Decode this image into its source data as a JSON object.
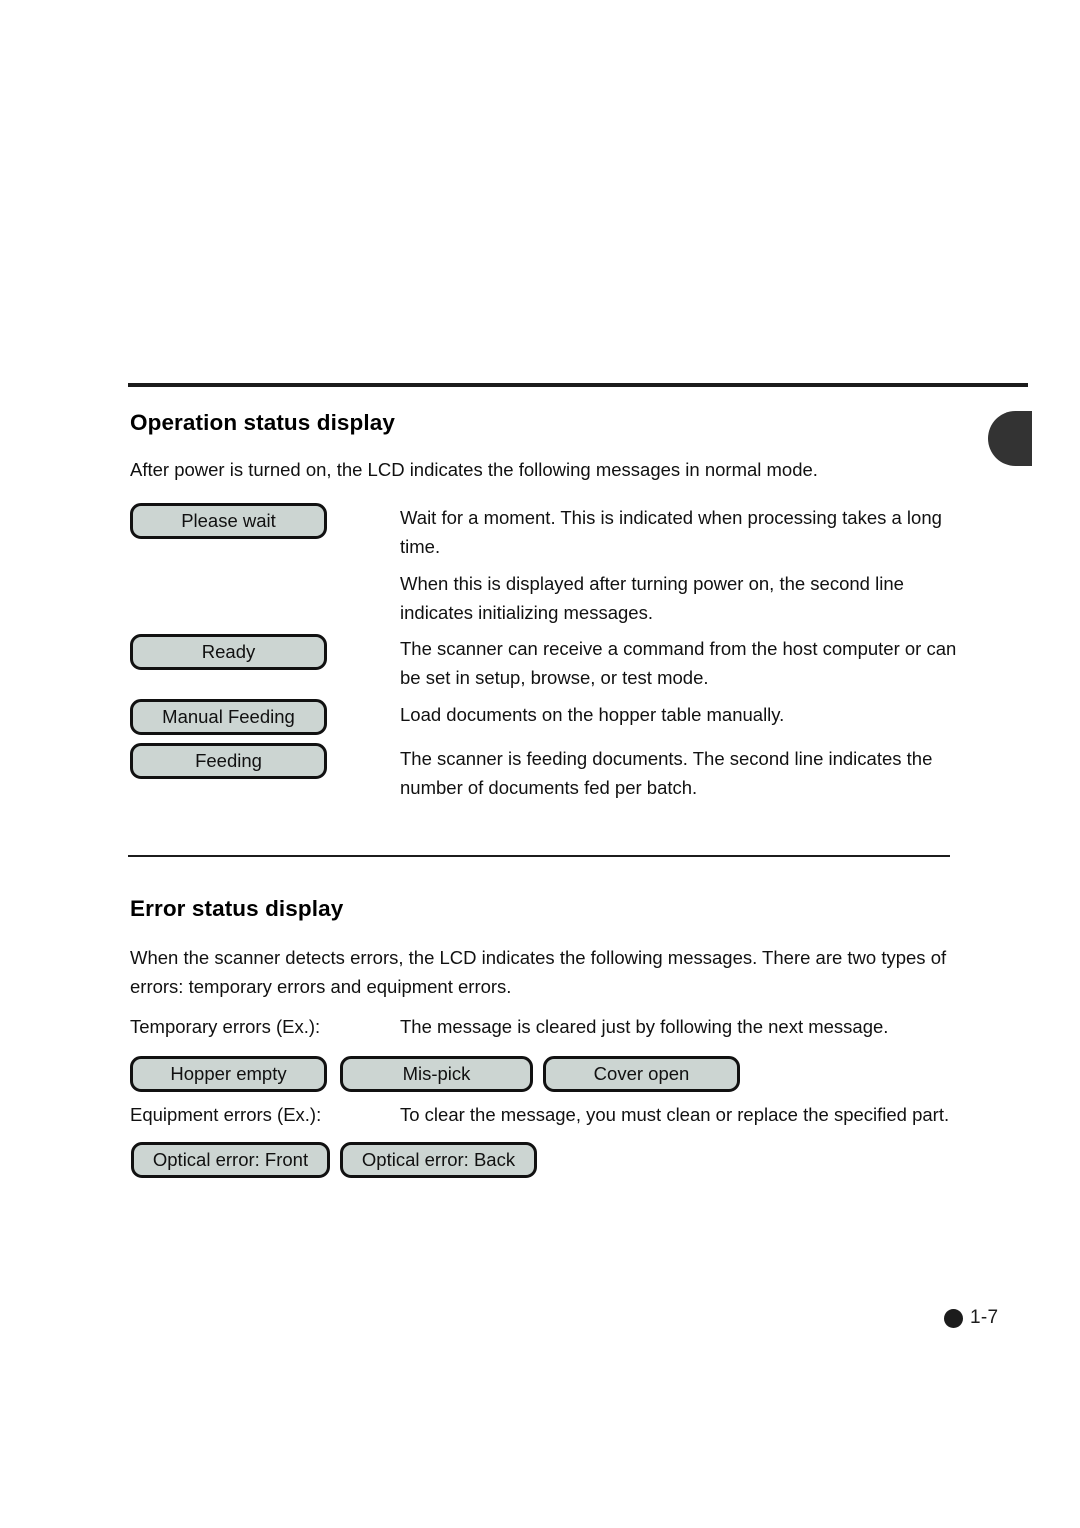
{
  "page": {
    "number_label": "1-7",
    "bullet_icon": "filled-circle-bullet",
    "tab_marker_icon": "page-edge-tab-marker",
    "accent_color": "#1c1c1c",
    "lcd_fill_color": "#ccd5d2"
  },
  "operation_section": {
    "heading": "Operation status display",
    "intro": "After power is turned on, the LCD indicates the following messages in normal mode.",
    "rows": [
      {
        "lcd_message": "Please wait",
        "descriptions": [
          "Wait for a moment.  This is indicated when processing takes a long time.",
          "When this is displayed after turning power on, the second line indicates initializing messages."
        ]
      },
      {
        "lcd_message": "Ready",
        "descriptions": [
          "The scanner can receive a command from the host computer  or can be set in setup, browse, or test mode."
        ]
      },
      {
        "lcd_message": "Manual Feeding",
        "descriptions": [
          "Load documents on the hopper table manually."
        ]
      },
      {
        "lcd_message": "Feeding",
        "descriptions": [
          "The scanner is feeding documents.  The second line indicates the number of documents fed per batch."
        ]
      }
    ]
  },
  "error_section": {
    "heading": "Error status display",
    "intro": "When the scanner detects errors, the LCD indicates the following messages.  There are two types of errors: temporary errors and equipment errors.",
    "temporary": {
      "label": "Temporary errors (Ex.):",
      "description": "The message is cleared just by following the next message.",
      "messages": [
        "Hopper empty",
        "Mis-pick",
        "Cover open"
      ]
    },
    "equipment": {
      "label": "Equipment errors (Ex.):",
      "description": "To clear the message, you must clean or replace the specified part.",
      "messages": [
        "Optical error: Front",
        "Optical error: Back"
      ]
    }
  }
}
